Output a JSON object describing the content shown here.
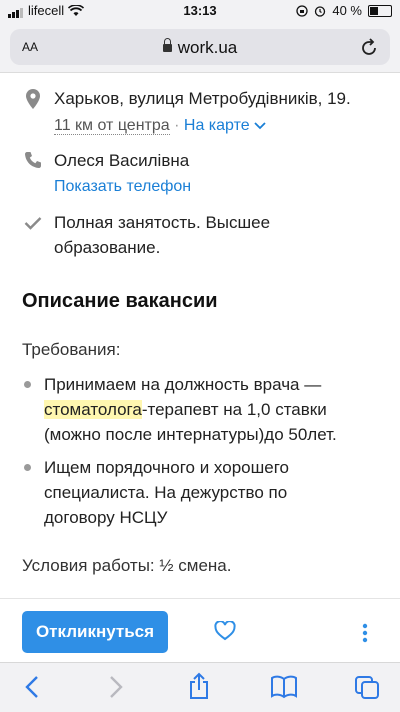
{
  "status_bar": {
    "carrier": "lifecell",
    "time": "13:13",
    "battery": "40 %"
  },
  "browser": {
    "text_size_label": "AA",
    "domain": "work.ua"
  },
  "job": {
    "address": "Харьков, вулиця Метробудівників, 19.",
    "distance": "11 км от центра",
    "map_link": "На карте",
    "contact_name": "Олеся Василівна",
    "show_phone": "Показать телефон",
    "conditions_line1": "Полная занятость. Высшее",
    "conditions_line2": "образование."
  },
  "description": {
    "heading": "Описание вакансии",
    "requirements_label": "Требования:",
    "items": [
      {
        "line1": "Принимаем на должность врача —",
        "highlight": "стоматолога",
        "line2_rest": "-терапевт на 1,0 ставки",
        "line3": "(можно после интернатуры)до 50лет."
      },
      {
        "line1": "Ищем порядочного и хорошего",
        "line2": "специалиста. На дежурство по",
        "line3": "договору НСЦУ"
      }
    ],
    "work_conditions": "Условия работы: ½ смена."
  },
  "actions": {
    "apply_label": "Откликнуться"
  },
  "colors": {
    "accent": "#2f8fe6",
    "link": "#1a7fd6",
    "highlight": "#fff7b0"
  }
}
